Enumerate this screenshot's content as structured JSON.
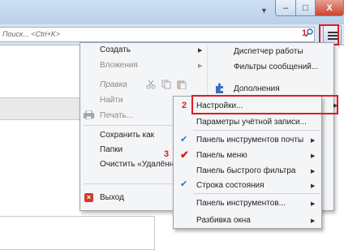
{
  "titlebar": {
    "tab_arrow": "▼",
    "minimize": "–",
    "maximize": "□",
    "close": "X"
  },
  "search": {
    "placeholder": "Поиск... <Ctrl+K>"
  },
  "annotations": {
    "step1": "1",
    "step2": "2",
    "step3": "3"
  },
  "main_menu": {
    "left": [
      {
        "label": "Создать",
        "arrow": "▶"
      },
      {
        "label": "Вложения",
        "arrow": "▶"
      },
      {
        "label": "Правка"
      },
      {
        "label": "Найти",
        "arrow": "▶"
      },
      {
        "label": "Печать..."
      },
      {
        "label": "Сохранить как",
        "arrow": "▶"
      },
      {
        "label": "Папки",
        "arrow": "▶"
      },
      {
        "label": "Очистить «Удалённые»"
      },
      {
        "label": "Выход"
      }
    ],
    "right": [
      {
        "label": "Диспетчер работы"
      },
      {
        "label": "Фильтры сообщений..."
      },
      {
        "label": "Дополнения"
      }
    ]
  },
  "sub_menu": [
    {
      "label": "Настройки...",
      "arrow": "▶"
    },
    {
      "label": "Параметры учётной записи..."
    },
    {
      "label": "Панель инструментов почты",
      "checked": true,
      "arrow": "▶"
    },
    {
      "label": "Панель меню",
      "checked": true,
      "arrow": "▶"
    },
    {
      "label": "Панель быстрого фильтра",
      "arrow": "▶"
    },
    {
      "label": "Строка состояния",
      "checked": true,
      "arrow": "▶"
    },
    {
      "label": "Панель инструментов...",
      "arrow": "▶"
    },
    {
      "label": "Разбивка окна",
      "arrow": "▶"
    }
  ],
  "colors": {
    "highlight": "#e01b24",
    "check": "#2a74c9"
  }
}
